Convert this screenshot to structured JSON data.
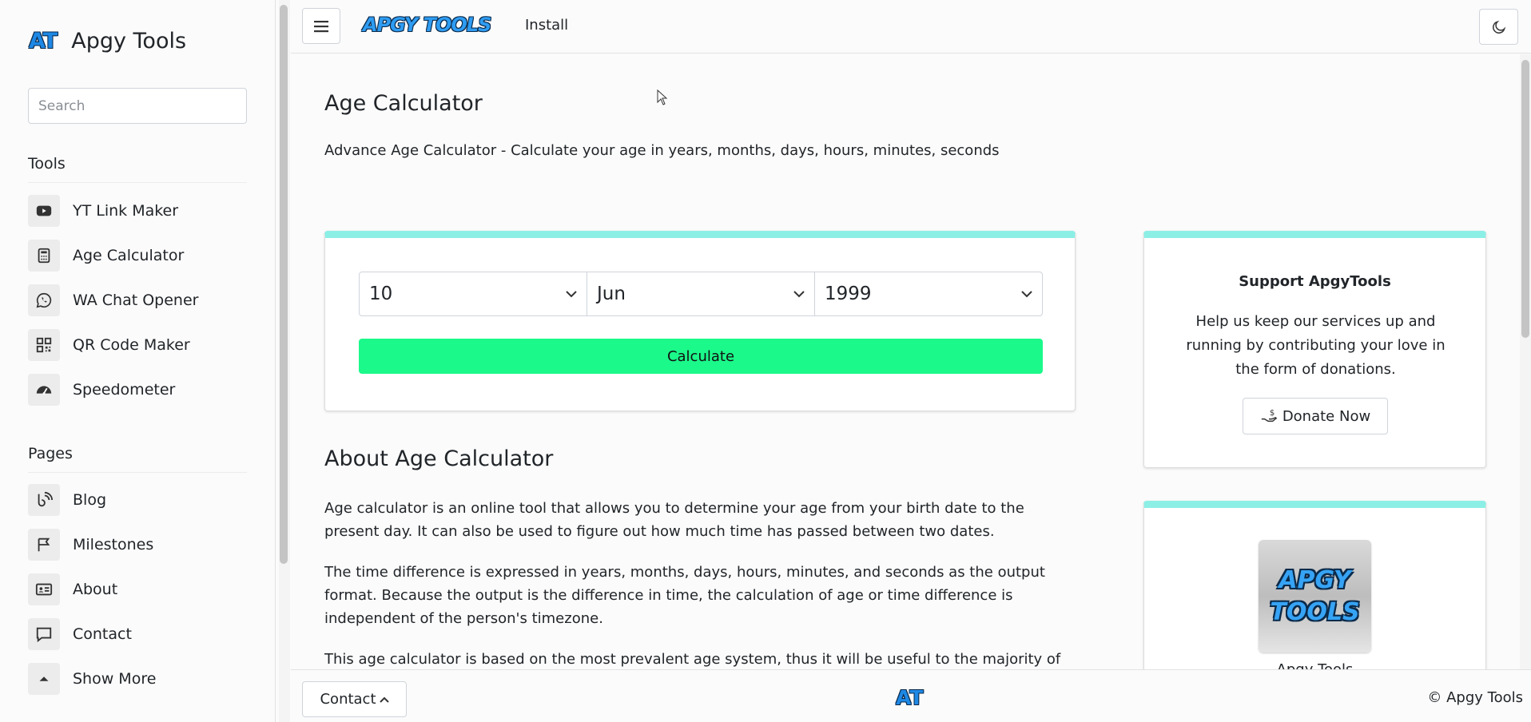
{
  "sidebar": {
    "brand_logo": "AT",
    "brand_name": "Apgy Tools",
    "search_placeholder": "Search",
    "tools_heading": "Tools",
    "tools": [
      {
        "label": "YT Link Maker",
        "icon": "youtube-icon"
      },
      {
        "label": "Age Calculator",
        "icon": "calculator-icon"
      },
      {
        "label": "WA Chat Opener",
        "icon": "whatsapp-icon"
      },
      {
        "label": "QR Code Maker",
        "icon": "qr-code-icon"
      },
      {
        "label": "Speedometer",
        "icon": "speedometer-icon"
      }
    ],
    "pages_heading": "Pages",
    "pages": [
      {
        "label": "Blog",
        "icon": "blog-icon"
      },
      {
        "label": "Milestones",
        "icon": "flag-icon"
      },
      {
        "label": "About",
        "icon": "id-card-icon"
      },
      {
        "label": "Contact",
        "icon": "chat-icon"
      },
      {
        "label": "Show More",
        "icon": "chevron-up-icon"
      }
    ]
  },
  "topbar": {
    "logo_text": "APGY TOOLS",
    "install_label": "Install"
  },
  "main": {
    "title": "Age Calculator",
    "description": "Advance Age Calculator - Calculate your age in years, months, days, hours, minutes, seconds",
    "calculator": {
      "day": "10",
      "month": "Jun",
      "year": "1999",
      "button_label": "Calculate"
    },
    "about_title": "About Age Calculator",
    "paragraphs": [
      "Age calculator is an online tool that allows you to determine your age from your birth date to the present day. It can also be used to figure out how much time has passed between two dates.",
      "The time difference is expressed in years, months, days, hours, minutes, and seconds as the output format. Because the output is the difference in time, the calculation of age or time difference is independent of the person's timezone.",
      "This age calculator is based on the most prevalent age system, thus it will be useful to the majority of"
    ]
  },
  "support": {
    "title": "Support ApgyTools",
    "text": "Help us keep our services up and running by contributing your love in the form of donations.",
    "donate_label": "Donate Now"
  },
  "logo_card": {
    "line1": "APGY",
    "line2": "TOOLS",
    "caption": "Apgy Tools"
  },
  "footer": {
    "contact_label": "Contact",
    "logo": "AT",
    "copyright": "© Apgy Tools"
  },
  "colors": {
    "accent_teal": "#8cefe6",
    "calculate_green": "#1bf98a",
    "brand_blue": "#1e88e5"
  }
}
